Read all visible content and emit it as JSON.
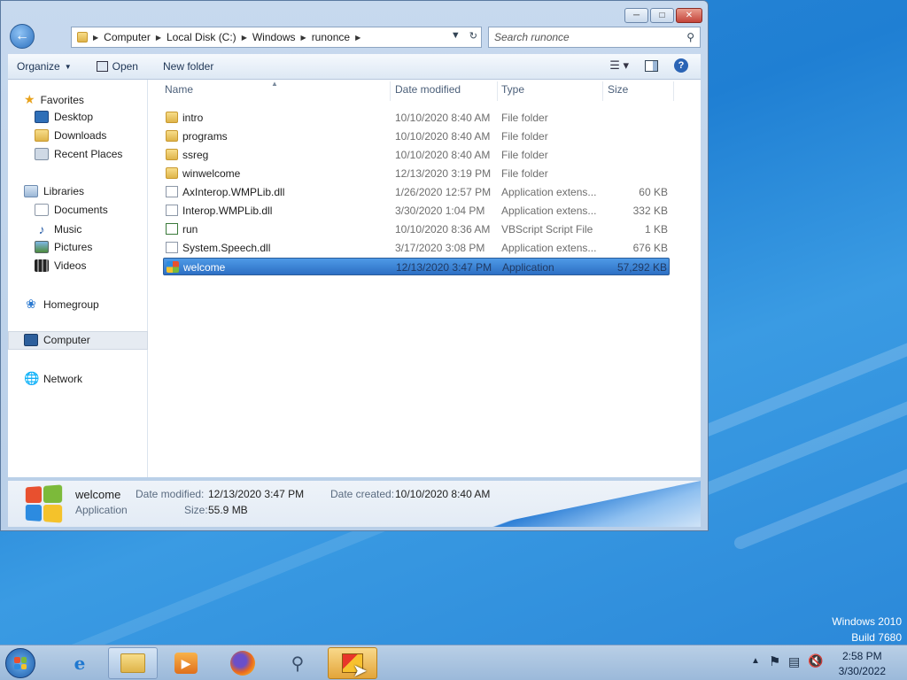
{
  "window": {
    "address_crumbs": [
      "Computer",
      "Local Disk (C:)",
      "Windows",
      "runonce"
    ],
    "search_placeholder": "Search runonce"
  },
  "toolbar": {
    "organize_label": "Organize",
    "open_label": "Open",
    "new_folder_label": "New folder"
  },
  "nav": {
    "favorites": "Favorites",
    "desktop": "Desktop",
    "downloads": "Downloads",
    "recent_places": "Recent Places",
    "libraries": "Libraries",
    "documents": "Documents",
    "music": "Music",
    "pictures": "Pictures",
    "videos": "Videos",
    "homegroup": "Homegroup",
    "computer": "Computer",
    "network": "Network"
  },
  "columns": {
    "name": "Name",
    "date_modified": "Date modified",
    "type": "Type",
    "size": "Size"
  },
  "files": [
    {
      "name": "intro",
      "date": "10/10/2020 8:40 AM",
      "type": "File folder",
      "size": "",
      "kind": "folder"
    },
    {
      "name": "programs",
      "date": "10/10/2020 8:40 AM",
      "type": "File folder",
      "size": "",
      "kind": "folder"
    },
    {
      "name": "ssreg",
      "date": "10/10/2020 8:40 AM",
      "type": "File folder",
      "size": "",
      "kind": "folder"
    },
    {
      "name": "winwelcome",
      "date": "12/13/2020 3:19 PM",
      "type": "File folder",
      "size": "",
      "kind": "folder"
    },
    {
      "name": "AxInterop.WMPLib.dll",
      "date": "1/26/2020 12:57 PM",
      "type": "Application extens...",
      "size": "60 KB",
      "kind": "dll"
    },
    {
      "name": "Interop.WMPLib.dll",
      "date": "3/30/2020 1:04 PM",
      "type": "Application extens...",
      "size": "332 KB",
      "kind": "dll"
    },
    {
      "name": "run",
      "date": "10/10/2020 8:36 AM",
      "type": "VBScript Script File",
      "size": "1 KB",
      "kind": "script"
    },
    {
      "name": "System.Speech.dll",
      "date": "3/17/2020 3:08 PM",
      "type": "Application extens...",
      "size": "676 KB",
      "kind": "dll"
    },
    {
      "name": "welcome",
      "date": "12/13/2020 3:47 PM",
      "type": "Application",
      "size": "57,292 KB",
      "kind": "app",
      "selected": true
    }
  ],
  "details": {
    "name": "welcome",
    "kind": "Application",
    "date_modified_label": "Date modified:",
    "date_modified": "12/13/2020 3:47 PM",
    "size_label": "Size:",
    "size": "55.9 MB",
    "date_created_label": "Date created:",
    "date_created": "10/10/2020 8:40 AM"
  },
  "desktop": {
    "watermark_line1": "Windows 2010",
    "watermark_line2": "Build 7680"
  },
  "taskbar": {
    "time": "2:58 PM",
    "date": "3/30/2022"
  },
  "colors": {
    "selection": "#3d86da",
    "desktop": "#2585d4"
  }
}
